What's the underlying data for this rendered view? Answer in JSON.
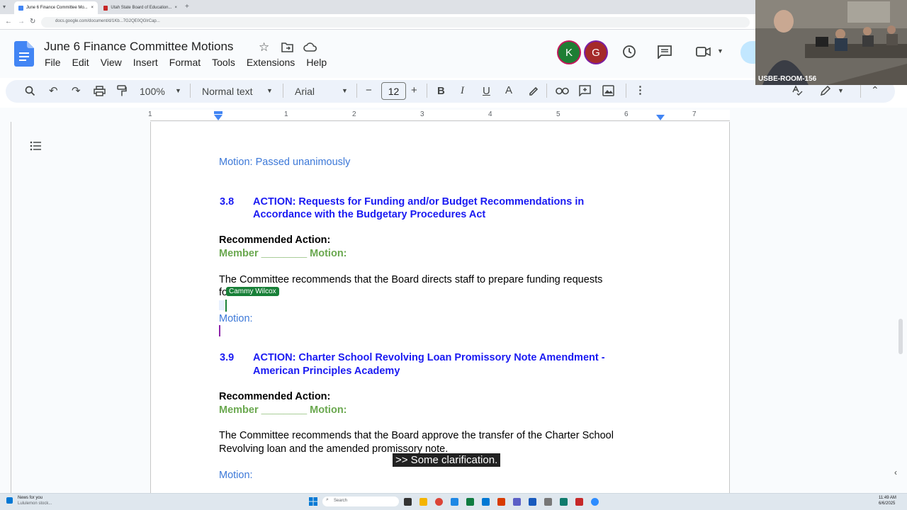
{
  "browser": {
    "tabs": [
      {
        "title": "June 6 Finance Committee Mo..."
      },
      {
        "title": "Utah State Board of Education..."
      }
    ],
    "new_tab": "+",
    "url": "docs.google.com/document/d/1Kb...7G2QE0QGlrCap..."
  },
  "doc": {
    "title": "June 6 Finance Committee Motions",
    "menu": [
      "File",
      "Edit",
      "View",
      "Insert",
      "Format",
      "Tools",
      "Extensions",
      "Help"
    ],
    "avatars": [
      {
        "letter": "K",
        "color": "#1e7e34"
      },
      {
        "letter": "G",
        "color": "#a52a2a"
      }
    ]
  },
  "toolbar": {
    "zoom": "100%",
    "style": "Normal text",
    "font": "Arial",
    "font_size": "12",
    "minus": "−",
    "plus": "+",
    "bold": "B",
    "italic": "I",
    "underline": "U",
    "color": "A"
  },
  "ruler": {
    "numbers": [
      "1",
      "1",
      "2",
      "3",
      "4",
      "5",
      "6",
      "7"
    ]
  },
  "content": {
    "motion_passed": "Motion: Passed unanimously",
    "s38_num": "3.8",
    "s38_title_l1": "ACTION: Requests for Funding and/or Budget Recommendations in",
    "s38_title_l2": "Accordance with the Budgetary Procedures Act",
    "rec_action_1": "Recommended Action:",
    "member_line_1": "Member ________ Motion:",
    "committee_text_1": "The Committee recommends that the Board directs staff to prepare funding requests",
    "committee_text_1b": "fo",
    "cursor_name": "Cammy Wilcox",
    "motion_1": "Motion:",
    "s39_num": "3.9",
    "s39_title_l1": "ACTION: Charter School Revolving Loan Promissory Note Amendment -",
    "s39_title_l2": "American Principles Academy",
    "rec_action_2": "Recommended Action:",
    "member_line_2": "Member ________ Motion:",
    "committee_text_2": "The Committee recommends that the Board approve the transfer of the Charter School",
    "committee_text_2b": "Revolving loan and the amended promissory note.",
    "motion_2": "Motion:"
  },
  "caption": ">> Some clarification.",
  "video": {
    "room_label": "USBE-ROOM-156"
  },
  "taskbar": {
    "news_title": "News for you",
    "news_sub": "Lululemon stock...",
    "search": "Search",
    "time": "11:49 AM",
    "date": "6/6/2025"
  }
}
